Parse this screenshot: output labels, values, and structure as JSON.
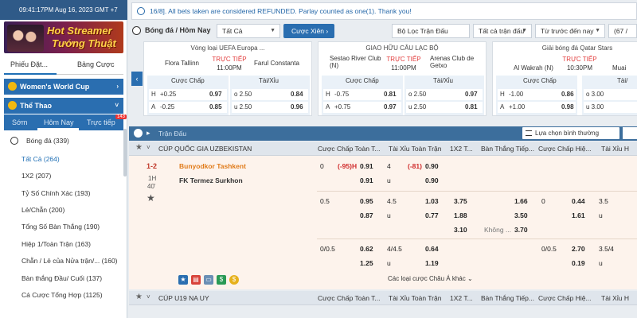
{
  "clock": "09:41:17PM Aug 16, 2023 GMT +7",
  "banner": {
    "line1": "Hot Streamer",
    "line2": "Tướng Thuật"
  },
  "bet_tabs": {
    "slip": "Phiếu Đặt...",
    "table": "Bảng Cược"
  },
  "sections": {
    "world_cup": "Women's World Cup",
    "sports": "Thể Thao"
  },
  "sport_tabs": {
    "early": "Sớm",
    "today": "Hôm Nay",
    "live": "Trực tiếp",
    "live_count": "143"
  },
  "sidebar_items": [
    {
      "label": "Bóng đá (339)"
    },
    {
      "label": "Tất Cả (264)"
    },
    {
      "label": "1X2 (207)"
    },
    {
      "label": "Tỷ Số Chính Xác (193)"
    },
    {
      "label": "Lẻ/Chẵn (200)"
    },
    {
      "label": "Tổng Số Bàn Thắng (190)"
    },
    {
      "label": "Hiệp 1/Toàn Trận (163)"
    },
    {
      "label": "Chẵn / Lẻ của Nửa trận/... (160)"
    },
    {
      "label": "Bàn thắng Đầu/ Cuối (137)"
    },
    {
      "label": "Cá Cược Tổng Hợp (1125)"
    }
  ],
  "notice": "16/8]. All bets taken are considered REFUNDED. Parlay counted as one(1). Thank you!",
  "filterbar": {
    "title": "Bóng đá / Hôm Nay",
    "all": "Tất Cả",
    "parlay_btn": "Cược Xiên",
    "league_filter": "Bộ Lọc Trận Đấu",
    "all_matches": "Tất cả trận đấu",
    "time_filter": "Từ trước đến nay",
    "page": "(67 /"
  },
  "cards": [
    {
      "league": "Vòng loại UEFA Europa ...",
      "home": "Flora Tallinn",
      "away": "Farul Constanta",
      "live": "TRỰC TIẾP",
      "time": "11:00PM",
      "h_label": "Cược Chấp",
      "ou_label": "Tài/Xỉu",
      "rows": [
        {
          "side": "H",
          "hcp": "+0.25",
          "odd": "0.97",
          "ou": "o 2.50",
          "ouv": "0.84"
        },
        {
          "side": "A",
          "hcp": "-0.25",
          "odd": "0.85",
          "ou": "u 2.50",
          "ouv": "0.96"
        }
      ]
    },
    {
      "league": "GIAO HỮU CÂU LẠC BỘ",
      "home": "Sestao River Club (N)",
      "away": "Arenas Club de Getxo",
      "live": "TRỰC TIẾP",
      "time": "11:00PM",
      "h_label": "Cược Chấp",
      "ou_label": "Tài/Xỉu",
      "rows": [
        {
          "side": "H",
          "hcp": "-0.75",
          "odd": "0.81",
          "ou": "o 2.50",
          "ouv": "0.97"
        },
        {
          "side": "A",
          "hcp": "+0.75",
          "odd": "0.97",
          "ou": "u 2.50",
          "ouv": "0.81"
        }
      ]
    },
    {
      "league": "Giải bóng đá Qatar Stars",
      "home": "Al Wakrah (N)",
      "away": "Muai",
      "live": "TRỰC TIẾP",
      "time": "10:30PM",
      "h_label": "Cược Chấp",
      "ou_label": "Tài/",
      "rows": [
        {
          "side": "H",
          "hcp": "-1.00",
          "odd": "0.86",
          "ou": "o 3.00",
          "ouv": ""
        },
        {
          "side": "A",
          "hcp": "+1.00",
          "odd": "0.98",
          "ou": "u 3.00",
          "ouv": ""
        }
      ]
    }
  ],
  "table": {
    "header": "Trận Đấu",
    "sort": "Lựa chọn bình thường",
    "columns": [
      "Cược Chấp Toàn T...",
      "Tài Xỉu Toàn Trận",
      "1X2 T...",
      "Bàn Thắng Tiếp...",
      "Cược Chấp Hiệ...",
      "Tài Xỉu H"
    ]
  },
  "league1": "CÚP QUỐC GIA UZBEKISTAN",
  "league2": "CÚP U19 NA UY",
  "match": {
    "score": "1-2",
    "half": "1H",
    "minute": "40'",
    "home": "Bunyodkor Tashkent",
    "away": "FK Termez Surkhon",
    "r1": {
      "hcp": "0",
      "hcp_red": "(-95)H",
      "hcp_odd": "0.91",
      "ou": "4",
      "ou_red": "(-81)",
      "ou_odd": "0.90"
    },
    "r2": {
      "hcp_odd": "0.91",
      "ou": "u",
      "ou_odd": "0.90"
    },
    "r3": {
      "hcp": "0.5",
      "hcp_odd": "0.95",
      "ou": "4.5",
      "ou_odd": "1.03",
      "x12": "3.75",
      "next": "1.66",
      "h1hcp": "0",
      "h1odd": "0.44",
      "h1ou": "3.5"
    },
    "r4": {
      "hcp_odd": "0.87",
      "ou": "u",
      "ou_odd": "0.77",
      "x12": "1.88",
      "next": "3.50",
      "h1odd": "1.61",
      "h1ou": "u"
    },
    "r5": {
      "x12": "3.10",
      "next_lbl": "Không ...",
      "next": "3.70"
    },
    "r6": {
      "hcp": "0/0.5",
      "hcp_odd": "0.62",
      "ou": "4/4.5",
      "ou_odd": "0.64",
      "h1hcp": "0/0.5",
      "h1odd": "2.70",
      "h1ou": "3.5/4"
    },
    "r7": {
      "hcp_odd": "1.25",
      "ou": "u",
      "ou_odd": "1.19",
      "h1odd": "0.19",
      "h1ou": "u"
    },
    "more": "Các loại cược Châu Á khác ⌄"
  }
}
